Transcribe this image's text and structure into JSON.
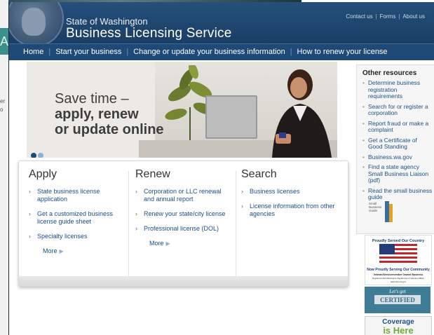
{
  "background": {
    "tab_letter": "A",
    "side_text_1": "er",
    "side_text_2": "o"
  },
  "header": {
    "state": "State of Washington",
    "title": "Business Licensing Service",
    "links": [
      "Contact us",
      "Forms",
      "About us"
    ]
  },
  "nav": {
    "items": [
      "Home",
      "Start your business",
      "Change or update your business information",
      "How to renew your license"
    ]
  },
  "hero": {
    "line1": "Save time –",
    "line2": "apply, renew",
    "line3": "or update online"
  },
  "panels": {
    "apply": {
      "title": "Apply",
      "items": [
        "State business license application",
        "Get a customized business license guide sheet",
        "Specialty licenses"
      ],
      "more": "More"
    },
    "renew": {
      "title": "Renew",
      "items": [
        "Corporation or LLC renewal and annual report",
        "Renew your state/city license",
        "Professional license (DOL)"
      ],
      "more": "More"
    },
    "search": {
      "title": "Search",
      "items": [
        "Business licenses",
        "License information from other agencies"
      ]
    }
  },
  "sidebar": {
    "title": "Other resources",
    "items": [
      "Determine business registration requirements",
      "Search for or register a corporation",
      "Report fraud or make a complaint",
      "Get a Certificate of Good Standing",
      "Business.wa.gov",
      "Find a state agency Small Business Liaison (pdf)",
      "Read the small business guide"
    ],
    "guide_text": [
      "Small",
      "Business",
      "Guide"
    ]
  },
  "badges": {
    "veteran_top": "Proudly Served Our Country",
    "veteran_bottom": "Now Proudly Serving Our Community",
    "veteran_line1": "Veteran/Servicemember Owned Business",
    "veteran_line2": "Registered with Washington Department of Veterans Affairs",
    "veteran_line3": "www.dva.wa.gov",
    "certified_top": "Let's get",
    "certified_main": "CERTIFIED",
    "coverage_line1": "Coverage",
    "coverage_line2": "is Here"
  }
}
